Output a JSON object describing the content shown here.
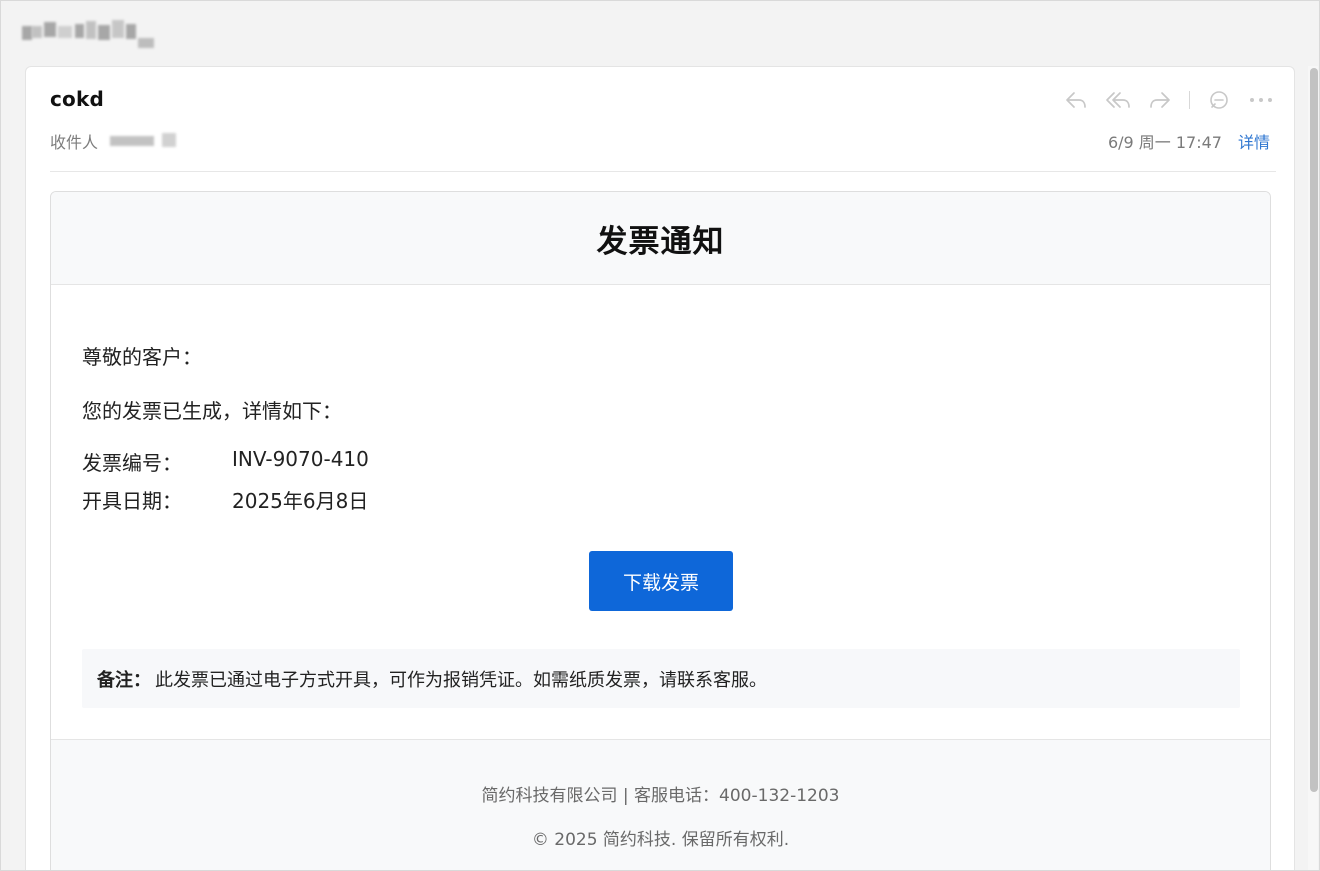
{
  "mail_header": {
    "sender_name": "cokd",
    "recipient_label": "收件人",
    "timestamp": "6/9 周一 17:47",
    "details_link": "详情"
  },
  "toolbar": {
    "actions": [
      {
        "icon": "reply-icon"
      },
      {
        "icon": "reply-all-icon"
      },
      {
        "icon": "forward-icon"
      },
      {
        "icon": "comment-icon"
      },
      {
        "icon": "more-icon"
      }
    ]
  },
  "invoice": {
    "title": "发票通知",
    "greeting": "尊敬的客户：",
    "intro": "您的发票已生成，详情如下：",
    "fields": [
      {
        "label": "发票编号：",
        "value": "INV-9070-410"
      },
      {
        "label": "开具日期：",
        "value": "2025年6月8日"
      }
    ],
    "download_button": "下载发票",
    "note_label": "备注：",
    "note_text": "此发票已通过电子方式开具，可作为报销凭证。如需纸质发票，请联系客服。"
  },
  "footer": {
    "line1": "简约科技有限公司 | 客服电话：400-132-1203",
    "line2": "© 2025 简约科技. 保留所有权利."
  },
  "colors": {
    "accent_blue": "#0E67D9",
    "link_blue": "#2F77D1",
    "panel_bg": "#F8F9FA"
  }
}
